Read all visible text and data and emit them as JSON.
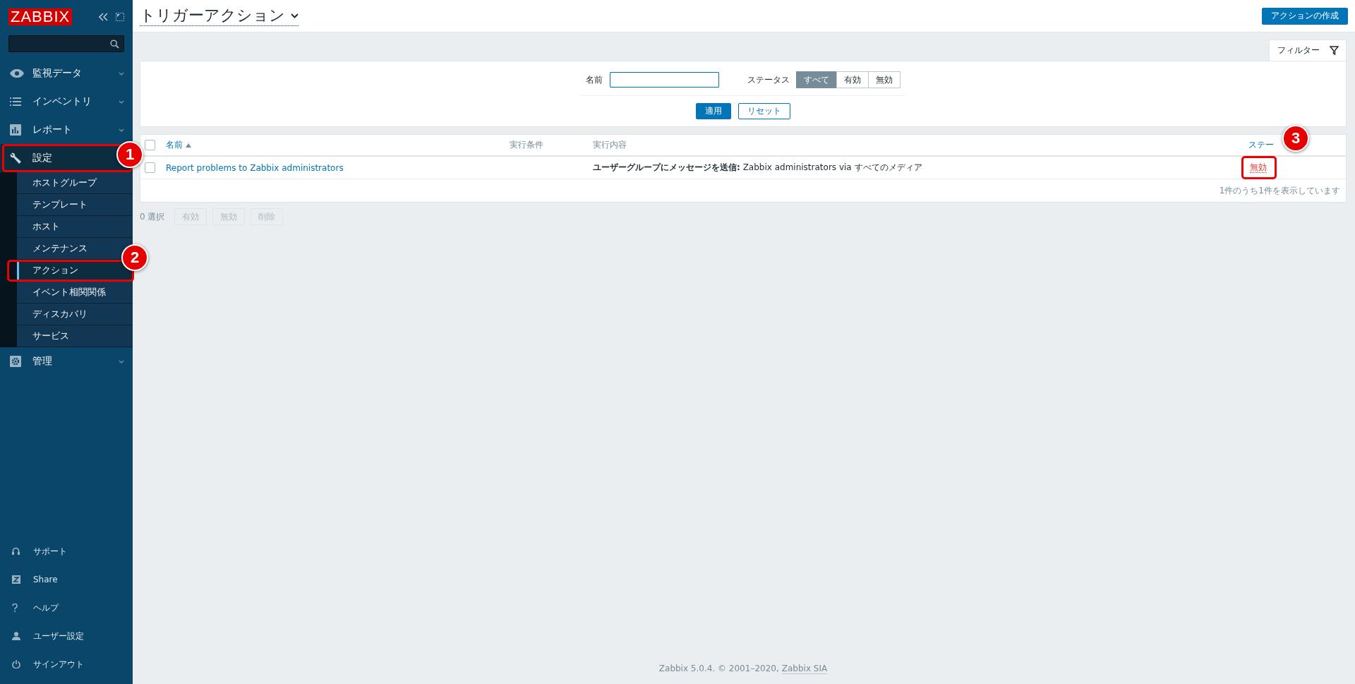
{
  "logo": "ZABBIX",
  "sidebar": {
    "menu": [
      {
        "label": "監視データ",
        "expanded": false,
        "selected": false
      },
      {
        "label": "インベントリ",
        "expanded": false,
        "selected": false
      },
      {
        "label": "レポート",
        "expanded": false,
        "selected": false
      },
      {
        "label": "設定",
        "expanded": true,
        "selected": true,
        "callout": "1",
        "children": [
          {
            "label": "ホストグループ",
            "selected": false
          },
          {
            "label": "テンプレート",
            "selected": false
          },
          {
            "label": "ホスト",
            "selected": false
          },
          {
            "label": "メンテナンス",
            "selected": false
          },
          {
            "label": "アクション",
            "selected": true,
            "callout": "2"
          },
          {
            "label": "イベント相関関係",
            "selected": false
          },
          {
            "label": "ディスカバリ",
            "selected": false
          },
          {
            "label": "サービス",
            "selected": false
          }
        ]
      },
      {
        "label": "管理",
        "expanded": false,
        "selected": false
      }
    ],
    "bottom_links": [
      {
        "label": "サポート"
      },
      {
        "label": "Share"
      },
      {
        "label": "ヘルプ"
      },
      {
        "label": "ユーザー設定"
      },
      {
        "label": "サインアウト"
      }
    ]
  },
  "header": {
    "title": "トリガーアクション",
    "create_button": "アクションの作成"
  },
  "filter": {
    "tab_label": "フィルター",
    "name_label": "名前",
    "status_label": "ステータス",
    "status_options": [
      {
        "label": "すべて",
        "selected": true
      },
      {
        "label": "有効",
        "selected": false
      },
      {
        "label": "無効",
        "selected": false
      }
    ],
    "apply": "適用",
    "reset": "リセット"
  },
  "table": {
    "select_all_checked": false,
    "columns": [
      {
        "label": "名前",
        "sorted": true,
        "link": true
      },
      {
        "label": "実行条件",
        "sorted": false,
        "link": false
      },
      {
        "label": "実行内容",
        "sorted": false,
        "link": false
      },
      {
        "label": "ステー",
        "sorted": false,
        "link": true
      }
    ],
    "rows": [
      {
        "checked": false,
        "name": "Report problems to Zabbix administrators",
        "operations": "**ユーザーグループにメッセージを送信:** Zabbix administrators via すべてのメディア",
        "status": "無効",
        "enabled": false,
        "callout": "3"
      }
    ],
    "summary": "1件のうち1件を表示しています"
  },
  "mass_actions": {
    "selected_count": "0 選択",
    "buttons": [
      {
        "label": "有効",
        "disabled": true
      },
      {
        "label": "無効",
        "disabled": true
      },
      {
        "label": "削除",
        "disabled": true
      }
    ]
  },
  "footer": {
    "text": "Zabbix 5.0.4. © 2001–2020,",
    "link": "Zabbix SIA"
  }
}
